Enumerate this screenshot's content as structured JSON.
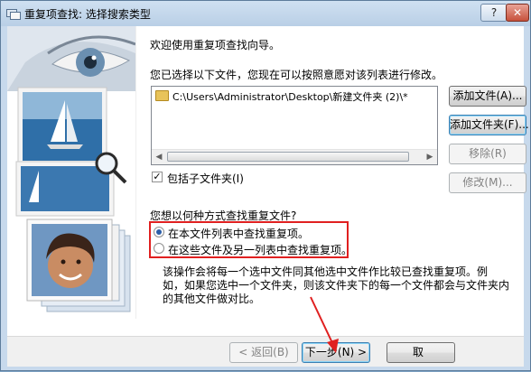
{
  "window": {
    "title": "重复项查找: 选择搜索类型",
    "help_glyph": "?",
    "close_glyph": "✕"
  },
  "wizard": {
    "welcome": "欢迎使用重复项查找向导。",
    "selected_files_prompt": "您已选择以下文件，您现在可以按照意愿对该列表进行修改。",
    "file_list": [
      "C:\\Users\\Administrator\\Desktop\\新建文件夹 (2)\\*"
    ],
    "buttons": {
      "add_file": "添加文件(A)...",
      "add_folder": "添加文件夹(F)...",
      "remove": "移除(R)",
      "modify": "修改(M)..."
    },
    "include_subfolders": {
      "label": "包括子文件夹(I)",
      "checked": true
    },
    "search_question": "您想以何种方式查找重复文件?",
    "options": [
      {
        "label": "在本文件列表中查找重复项。",
        "checked": true
      },
      {
        "label": "在这些文件及另一列表中查找重复项。",
        "checked": false
      }
    ],
    "description_line1": "该操作会将每一个选中文件同其他选中文件作比较已查找重复项。例",
    "description_line2": "如，如果您选中一个文件夹，则该文件夹下的每一个文件都会与文件夹内",
    "description_line3": "的其他文件做对比。"
  },
  "footer": {
    "back": "< 返回(B)",
    "next": "下一步(N) >",
    "cancel": "取"
  },
  "colors": {
    "highlight_box": "#e02020",
    "annotation_arrow": "#e02020"
  }
}
